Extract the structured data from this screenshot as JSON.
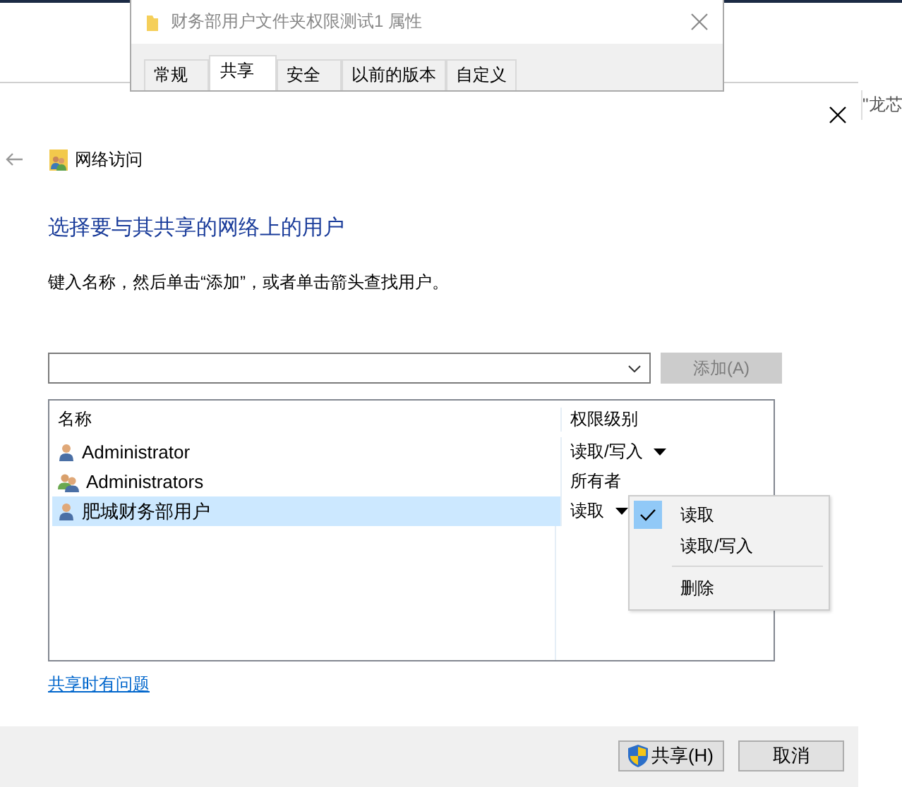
{
  "property_window": {
    "title": "财务部用户文件夹权限测试1 属性",
    "tabs": [
      {
        "label": "常规",
        "selected": false
      },
      {
        "label": "共享",
        "selected": true
      },
      {
        "label": "安全",
        "selected": false
      },
      {
        "label": "以前的版本",
        "selected": false
      },
      {
        "label": "自定义",
        "selected": false
      }
    ]
  },
  "side_fragment": "\"龙芯",
  "wizard": {
    "nav_title": "网络访问",
    "heading": "选择要与其共享的网络上的用户",
    "instruction": "键入名称，然后单击“添加”，或者单击箭头查找用户。",
    "add_button": {
      "label": "添加(A)",
      "disabled": true
    },
    "list": {
      "columns": [
        "名称",
        "权限级别"
      ],
      "rows": [
        {
          "name": "Administrator",
          "kind": "user",
          "permission": "读取/写入",
          "dropdown": true,
          "selected": false
        },
        {
          "name": "Administrators",
          "kind": "group",
          "permission": "所有者",
          "dropdown": false,
          "selected": false
        },
        {
          "name": "肥城财务部用户",
          "kind": "user",
          "permission": "读取",
          "dropdown": true,
          "selected": true
        }
      ]
    },
    "menu": {
      "items": [
        {
          "kind": "option",
          "label": "读取",
          "checked": true
        },
        {
          "kind": "option",
          "label": "读取/写入",
          "checked": false
        },
        {
          "kind": "separator"
        },
        {
          "kind": "option",
          "label": "删除",
          "checked": false
        }
      ]
    },
    "help_link": "共享时有问题",
    "buttons": [
      {
        "label": "共享(H)",
        "shield": true
      },
      {
        "label": "取消",
        "shield": false
      }
    ]
  }
}
